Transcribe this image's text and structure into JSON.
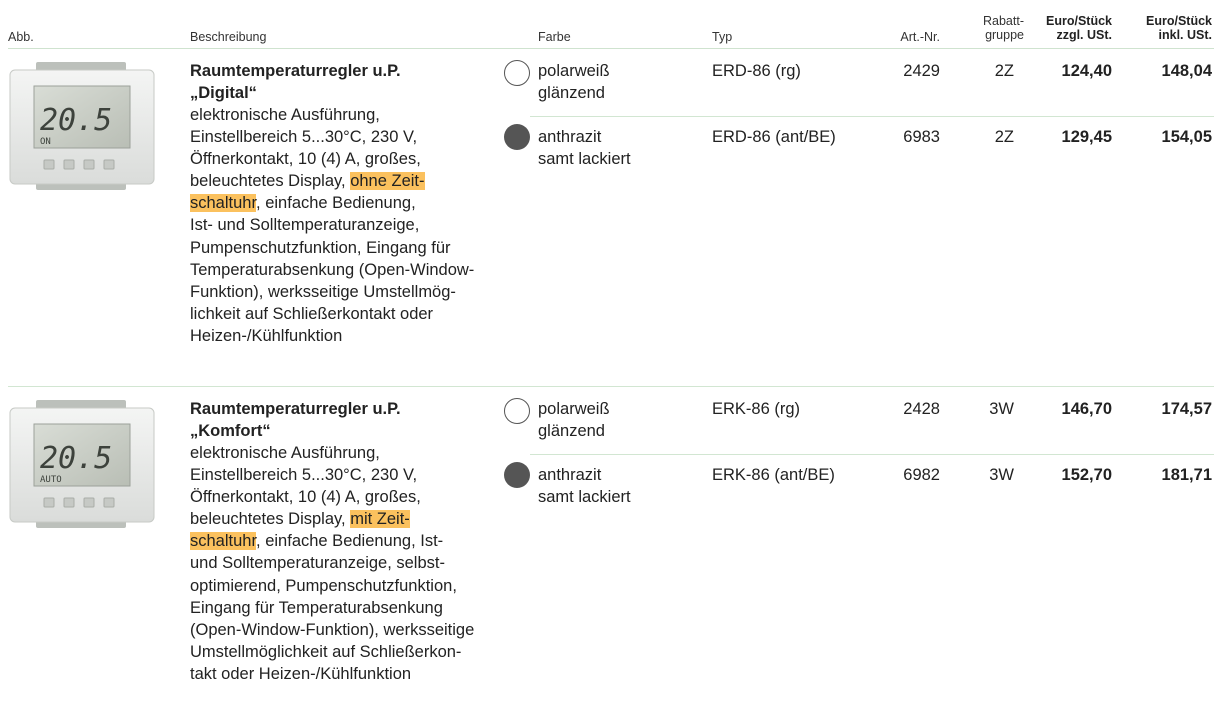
{
  "header": {
    "abb": "Abb.",
    "beschreibung": "Beschreibung",
    "farbe": "Farbe",
    "typ": "Typ",
    "artnr": "Art.-Nr.",
    "rabatt_line1": "Rabatt-",
    "rabatt_line2": "gruppe",
    "euro_zzgl_line1": "Euro/Stück",
    "euro_zzgl_line2": "zzgl. USt.",
    "euro_inkl_line1": "Euro/Stück",
    "euro_inkl_line2": "inkl. USt."
  },
  "products": [
    {
      "title_line1": "Raumtemperaturregler u.P.",
      "title_line2": "„Digital“",
      "display_temp": "20.5",
      "display_status": "ON",
      "description": {
        "l1": "elektronische Ausführung,",
        "l2": "Einstellbereich 5...30°C, 230 V,",
        "l3": "Öffnerkontakt, 10 (4) A, großes,",
        "l4_pre": "beleuchtetes Display, ",
        "l4_hl": "ohne Zeit-",
        "l5_hl": "schaltuhr",
        "l5_post": ", einfache Bedienung,",
        "l6": "Ist- und Solltemperaturanzeige,",
        "l7": "Pumpenschutzfunktion, Eingang für",
        "l8": "Temperaturabsenkung (Open-Window-",
        "l9": "Funktion), werksseitige Umstellmög-",
        "l10": "lichkeit auf Schließerkontakt oder",
        "l11": "Heizen-/Kühlfunktion"
      },
      "variants": [
        {
          "color_line1": "polarweiß",
          "color_line2": "glänzend",
          "typ": "ERD-86 (rg)",
          "artnr": "2429",
          "rabatt": "2Z",
          "zzgl": "124,40",
          "inkl": "148,04"
        },
        {
          "color_line1": "anthrazit",
          "color_line2": "samt lackiert",
          "typ": "ERD-86 (ant/BE)",
          "artnr": "6983",
          "rabatt": "2Z",
          "zzgl": "129,45",
          "inkl": "154,05"
        }
      ]
    },
    {
      "title_line1": "Raumtemperaturregler u.P.",
      "title_line2": "„Komfort“",
      "display_temp": "20.5",
      "display_status": "AUTO",
      "description": {
        "l1": "elektronische Ausführung,",
        "l2": "Einstellbereich 5...30°C, 230 V,",
        "l3": "Öffnerkontakt, 10 (4) A, großes,",
        "l4_pre": "beleuchtetes Display, ",
        "l4_hl": "mit Zeit-",
        "l5_hl": "schaltuhr",
        "l5_post": ", einfache Bedienung, Ist-",
        "l6": "und Solltemperaturanzeige, selbst-",
        "l7": "optimierend, Pumpenschutzfunktion,",
        "l8": "Eingang für Temperaturabsenkung",
        "l9": "(Open-Window-Funktion), werksseitige",
        "l10": "Umstellmöglichkeit auf Schließerkon-",
        "l11": "takt oder Heizen-/Kühlfunktion"
      },
      "variants": [
        {
          "color_line1": "polarweiß",
          "color_line2": "glänzend",
          "typ": "ERK-86 (rg)",
          "artnr": "2428",
          "rabatt": "3W",
          "zzgl": "146,70",
          "inkl": "174,57"
        },
        {
          "color_line1": "anthrazit",
          "color_line2": "samt lackiert",
          "typ": "ERK-86 (ant/BE)",
          "artnr": "6982",
          "rabatt": "3W",
          "zzgl": "152,70",
          "inkl": "181,71"
        }
      ]
    }
  ],
  "colors": {
    "highlight": "#fbc15e",
    "separator": "#d2e6d2",
    "swatch_dark": "#555555",
    "swatch_light": "#ffffff"
  }
}
